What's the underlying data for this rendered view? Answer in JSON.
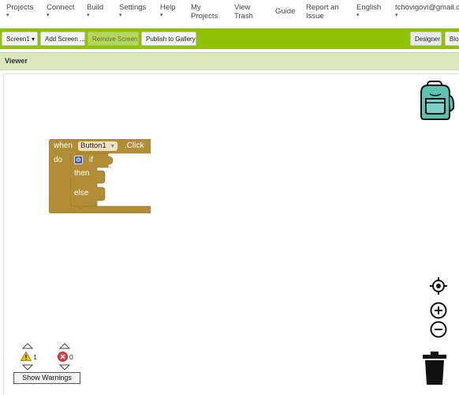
{
  "menubar": {
    "items": [
      {
        "label": "Projects",
        "dropdown": true
      },
      {
        "label": "Connect",
        "dropdown": true
      },
      {
        "label": "Build",
        "dropdown": true
      },
      {
        "label": "Settings",
        "dropdown": true
      },
      {
        "label": "Help",
        "dropdown": true
      },
      {
        "label": "My\nProjects",
        "dropdown": false
      },
      {
        "label": "View\nTrash",
        "dropdown": false
      },
      {
        "label": "Guide",
        "dropdown": false
      },
      {
        "label": "Report an\nIssue",
        "dropdown": false
      },
      {
        "label": "English",
        "dropdown": true
      },
      {
        "label": "tchovigovi@gmail.com",
        "dropdown": true
      }
    ],
    "caret": "▾"
  },
  "toolbar": {
    "screen_select": "Screen1 ▾",
    "add_screen": "Add Screen ...",
    "remove_screen": "Remove Screen",
    "publish": "Publish to Gallery",
    "designer": "Designer",
    "blocks": "Blocks"
  },
  "viewer": {
    "title": "Viewer"
  },
  "workspace": {
    "event_block": {
      "when": "when",
      "component": "Button1",
      "event": ".Click",
      "do": "do",
      "color": "#b18e35"
    },
    "if_block": {
      "if": "if",
      "then": "then",
      "else": "else",
      "color": "#b18e35"
    }
  },
  "warnings": {
    "warning_count": "1",
    "error_count": "0",
    "button_label": "Show Warnings"
  },
  "colors": {
    "toolbar_green": "#8fc202",
    "block_gold": "#b18e35",
    "backpack_teal": "#5cc0b3"
  }
}
